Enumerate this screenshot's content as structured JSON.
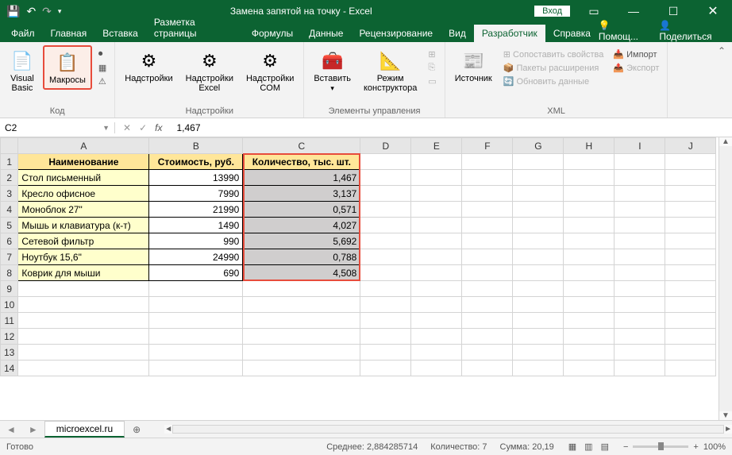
{
  "title": "Замена запятой на точку  -  Excel",
  "login": "Вход",
  "tabs": [
    "Файл",
    "Главная",
    "Вставка",
    "Разметка страницы",
    "Формулы",
    "Данные",
    "Рецензирование",
    "Вид",
    "Разработчик",
    "Справка"
  ],
  "active_tab": 8,
  "help_actions": {
    "help": "Помощ...",
    "share": "Поделиться"
  },
  "ribbon": {
    "code": {
      "label": "Код",
      "vb": "Visual\nBasic",
      "macros": "Макросы"
    },
    "addins": {
      "label": "Надстройки",
      "add": "Надстройки",
      "excel": "Надстройки\nExcel",
      "com": "Надстройки\nCOM"
    },
    "controls": {
      "label": "Элементы управления",
      "insert": "Вставить",
      "design": "Режим\nконструктора"
    },
    "xml": {
      "label": "XML",
      "source": "Источник",
      "map": "Сопоставить свойства",
      "expand": "Пакеты расширения",
      "refresh": "Обновить данные",
      "import": "Импорт",
      "export": "Экспорт"
    }
  },
  "name_box": "C2",
  "formula": "1,467",
  "columns": [
    "A",
    "B",
    "C",
    "D",
    "E",
    "F",
    "G",
    "H",
    "I",
    "J"
  ],
  "rows": [
    1,
    2,
    3,
    4,
    5,
    6,
    7,
    8,
    9,
    10,
    11,
    12,
    13,
    14
  ],
  "headers": {
    "a": "Наименование",
    "b": "Стоимость, руб.",
    "c": "Количество, тыс. шт."
  },
  "data": [
    {
      "a": "Стол письменный",
      "b": "13990",
      "c": "1,467"
    },
    {
      "a": "Кресло офисное",
      "b": "7990",
      "c": "3,137"
    },
    {
      "a": "Моноблок 27\"",
      "b": "21990",
      "c": "0,571"
    },
    {
      "a": "Мышь и клавиатура (к-т)",
      "b": "1490",
      "c": "4,027"
    },
    {
      "a": "Сетевой фильтр",
      "b": "990",
      "c": "5,692"
    },
    {
      "a": "Ноутбук 15,6\"",
      "b": "24990",
      "c": "0,788"
    },
    {
      "a": "Коврик для мыши",
      "b": "690",
      "c": "4,508"
    }
  ],
  "sheet": "microexcel.ru",
  "status": {
    "ready": "Готово",
    "avg_l": "Среднее:",
    "avg": "2,884285714",
    "cnt_l": "Количество:",
    "cnt": "7",
    "sum_l": "Сумма:",
    "sum": "20,19",
    "zoom": "100%"
  }
}
